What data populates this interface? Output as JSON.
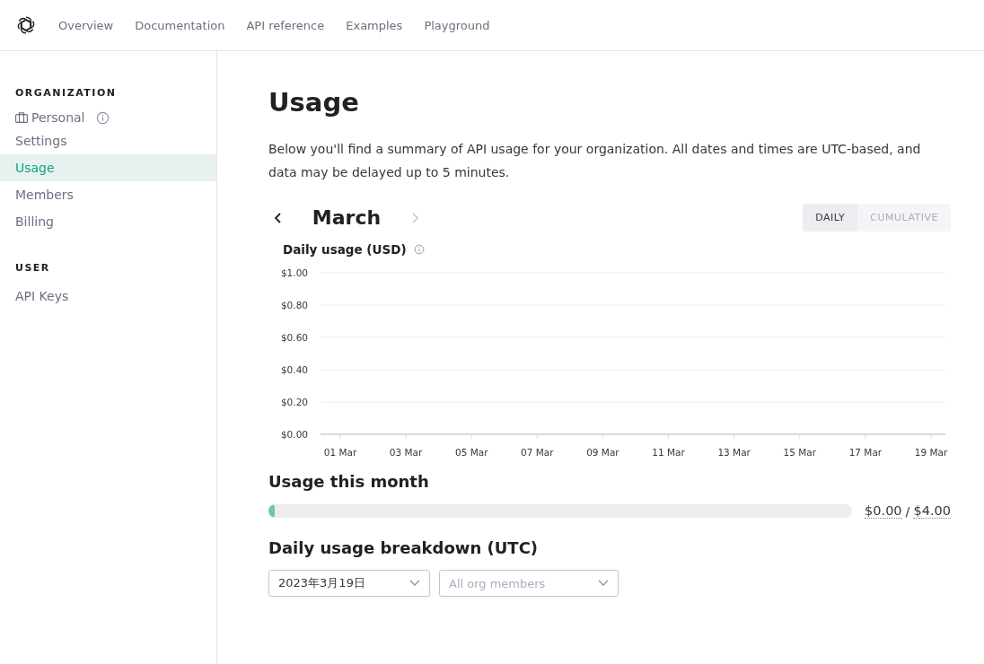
{
  "nav": {
    "links": [
      "Overview",
      "Documentation",
      "API reference",
      "Examples",
      "Playground"
    ]
  },
  "sidebar": {
    "sections": [
      {
        "heading": "ORGANIZATION",
        "org": "Personal",
        "items": [
          {
            "label": "Settings",
            "selected": false
          },
          {
            "label": "Usage",
            "selected": true
          },
          {
            "label": "Members",
            "selected": false
          },
          {
            "label": "Billing",
            "selected": false
          }
        ]
      },
      {
        "heading": "USER",
        "items": [
          {
            "label": "API Keys",
            "selected": false
          }
        ]
      }
    ]
  },
  "page": {
    "title": "Usage",
    "description": "Below you'll find a summary of API usage for your organization. All dates and times are UTC-based, and data may be delayed up to 5 minutes.",
    "month": "March",
    "next_disabled": true,
    "view_tabs": [
      {
        "label": "DAILY",
        "selected": true
      },
      {
        "label": "CUMULATIVE",
        "selected": false
      }
    ],
    "chart": {
      "title": "Daily usage (USD)",
      "chart_data": {
        "type": "bar",
        "grid": true,
        "categories": [
          "01 Mar",
          "03 Mar",
          "05 Mar",
          "07 Mar",
          "09 Mar",
          "11 Mar",
          "13 Mar",
          "15 Mar",
          "17 Mar",
          "19 Mar"
        ],
        "values": [
          0,
          0,
          0,
          0,
          0,
          0,
          0,
          0,
          0,
          0
        ],
        "ylim": [
          0,
          1
        ],
        "yticks": [
          {
            "value": 0,
            "label": "$0.00"
          },
          {
            "value": 0.2,
            "label": "$0.20"
          },
          {
            "value": 0.4,
            "label": "$0.40"
          },
          {
            "value": 0.6,
            "label": "$0.60"
          },
          {
            "value": 0.8,
            "label": "$0.80"
          },
          {
            "value": 1,
            "label": "$1.00"
          }
        ]
      }
    },
    "month_usage": {
      "title": "Usage this month",
      "level": 0.01,
      "used": "$0.00",
      "separator": "/",
      "limit": "$4.00"
    },
    "breakdown": {
      "title": "Daily usage breakdown (UTC)",
      "date_select": "2023年3月19日",
      "member_select": "All org members"
    }
  }
}
